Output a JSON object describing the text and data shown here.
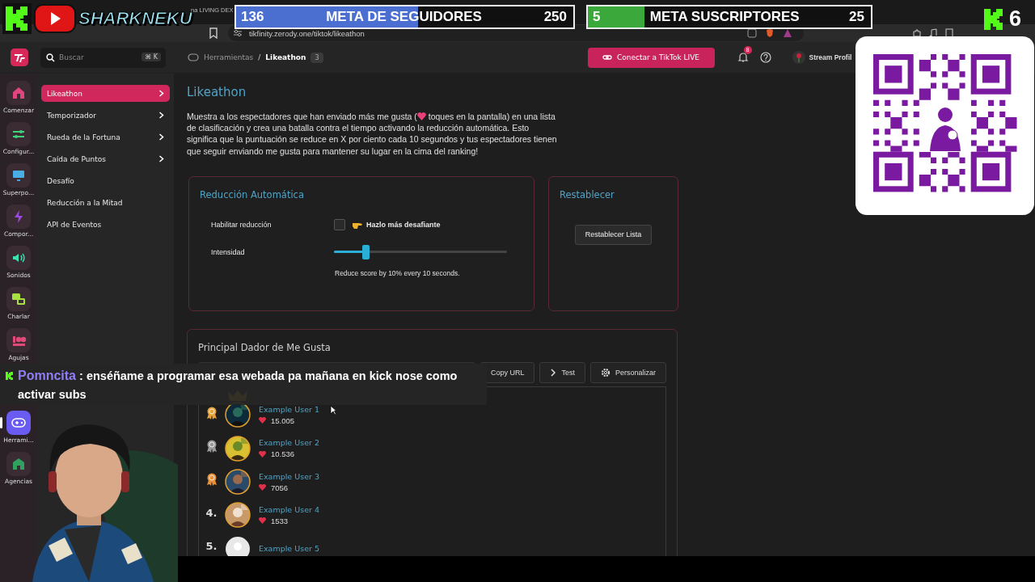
{
  "overlay": {
    "channel_name": "SHARKNEKU",
    "goals": [
      {
        "kind": "followers",
        "current": "136",
        "title": "META DE SEGUIDORES",
        "target": "250",
        "level": 0.54
      },
      {
        "kind": "subscribers",
        "current": "5",
        "title": "META SUSCRIPTORES",
        "target": "25",
        "level": 0.2
      }
    ],
    "viewer_count": "6",
    "chat": {
      "user": "Pomncita",
      "message": ": enséñame a programar esa webada pa mañana en kick nose como activar subs"
    }
  },
  "browser": {
    "tab_title": "na LIVING DEX",
    "address": "tikfinity.zerody.one/tiktok/likeathon"
  },
  "header": {
    "search_placeholder": "Buscar",
    "shortcut": "⌘ K",
    "breadcrumb": [
      "Herramientas",
      "Likeathon"
    ],
    "breadcrumb_separator": "/",
    "breadcrumb_badge": "3",
    "connect_button": "Conectar a TikTok LIVE",
    "notification_count": "8",
    "profile": "Stream Profil"
  },
  "rail": [
    {
      "label": "Comenzar",
      "color": "#e0457d",
      "selected": false
    },
    {
      "label": "Configur...",
      "color": "#3fd27a",
      "selected": false
    },
    {
      "label": "Superpo...",
      "color": "#4aaee6",
      "selected": false
    },
    {
      "label": "Compor...",
      "color": "#9a4ae0",
      "selected": false
    },
    {
      "label": "Sonidos",
      "color": "#3fe0b0",
      "selected": false
    },
    {
      "label": "Charlar",
      "color": "#a8e040",
      "selected": false
    },
    {
      "label": "Agujas",
      "color": "#e04a7a",
      "selected": false
    },
    {
      "label": "Herrami...",
      "color": "#ffffff",
      "selected": true
    },
    {
      "label": "Agencias",
      "color": "#2fa060",
      "selected": false
    }
  ],
  "submenu": [
    {
      "label": "Likeathon",
      "selected": true,
      "has_children": true
    },
    {
      "label": "Temporizador",
      "selected": false,
      "has_children": true
    },
    {
      "label": "Rueda de la Fortuna",
      "selected": false,
      "has_children": true
    },
    {
      "label": "Caída de Puntos",
      "selected": false,
      "has_children": true
    },
    {
      "label": "Desafío",
      "selected": false,
      "has_children": false
    },
    {
      "label": "Reducción a la Mitad",
      "selected": false,
      "has_children": false
    },
    {
      "label": "API de Eventos",
      "selected": false,
      "has_children": false
    }
  ],
  "page": {
    "title": "Likeathon",
    "description_before": "Muestra a los espectadores que han enviado más me gusta (",
    "description_after": " toques en la pantalla) en una lista de clasificación y crea una batalla contra el tiempo activando la reducción automática. Esto significa que la puntuación se reduce en X por ciento cada 10 segundos y tus espectadores tienen que seguir enviando me gusta para mantener su lugar en la cima del ranking!",
    "auto_reduction": {
      "title": "Reducción Automática",
      "enable_label": "Habilitar reducción",
      "enabled": false,
      "hint": "Hazlo más desafiante",
      "intensity_label": "Intensidad",
      "level": 0.18,
      "reading": "Reduce score by 10% every 10 seconds."
    },
    "reset": {
      "title": "Restablecer",
      "button": "Restablecer Lista"
    },
    "leaderboard": {
      "title": "Principal Dador de Me Gusta",
      "buttons": [
        "Copy URL",
        "Test",
        "Personalizar"
      ],
      "entries": [
        {
          "kind": "medal",
          "color": "#e8a33a",
          "crowned": true,
          "has_photo": true,
          "name": "Example User 1",
          "score": "15.005"
        },
        {
          "kind": "medal",
          "color": "#9a9a9a",
          "crowned": false,
          "has_photo": true,
          "name": "Example User 2",
          "score": "10.536"
        },
        {
          "kind": "medal",
          "color": "#e8913a",
          "crowned": false,
          "has_photo": true,
          "name": "Example User 3",
          "score": "7056"
        },
        {
          "kind": "number",
          "rank": "4.",
          "crowned": false,
          "has_photo": true,
          "name": "Example User 4",
          "score": "1533"
        },
        {
          "kind": "number",
          "rank": "5.",
          "crowned": false,
          "has_photo": false,
          "name": "Example User 5"
        }
      ]
    }
  }
}
